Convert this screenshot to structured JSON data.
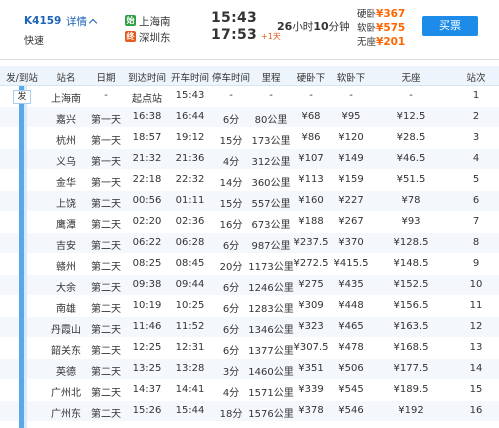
{
  "train": {
    "number": "K4159",
    "detail_label": "详情",
    "type": "快速",
    "from_badge": "始",
    "to_badge": "终",
    "from_station": "上海南",
    "to_station": "深圳东",
    "depart_time": "15:43",
    "arrive_time": "17:53",
    "day_offset": "+1天",
    "duration_hours": "26",
    "duration_hours_unit": "小时",
    "duration_minutes": "10",
    "duration_minutes_unit": "分钟",
    "prices": [
      {
        "seat": "硬卧",
        "value": "¥367"
      },
      {
        "seat": "软卧",
        "value": "¥575"
      },
      {
        "seat": "无座",
        "value": "¥201"
      }
    ],
    "buy_label": "买票"
  },
  "colors": {
    "accent_blue": "#1c8ce8",
    "price_orange": "#ff6600",
    "badge_green": "#2f9e44",
    "badge_orange": "#e55a1c"
  },
  "table": {
    "headers": [
      "发/到站",
      "站名",
      "日期",
      "到达时间",
      "开车时间",
      "停车时间",
      "里程",
      "硬卧下",
      "软卧下",
      "无座",
      "站次"
    ],
    "depart_marker": "发",
    "rows": [
      [
        "上海南",
        "-",
        "起点站",
        "15:43",
        "-",
        "-",
        "-",
        "-",
        "-",
        "1"
      ],
      [
        "嘉兴",
        "第一天",
        "16:38",
        "16:44",
        "6分",
        "80公里",
        "¥68",
        "¥95",
        "¥12.5",
        "2"
      ],
      [
        "杭州",
        "第一天",
        "18:57",
        "19:12",
        "15分",
        "173公里",
        "¥86",
        "¥120",
        "¥28.5",
        "3"
      ],
      [
        "义乌",
        "第一天",
        "21:32",
        "21:36",
        "4分",
        "312公里",
        "¥107",
        "¥149",
        "¥46.5",
        "4"
      ],
      [
        "金华",
        "第一天",
        "22:18",
        "22:32",
        "14分",
        "360公里",
        "¥113",
        "¥159",
        "¥51.5",
        "5"
      ],
      [
        "上饶",
        "第二天",
        "00:56",
        "01:11",
        "15分",
        "557公里",
        "¥160",
        "¥227",
        "¥78",
        "6"
      ],
      [
        "鹰潭",
        "第二天",
        "02:20",
        "02:36",
        "16分",
        "673公里",
        "¥188",
        "¥267",
        "¥93",
        "7"
      ],
      [
        "吉安",
        "第二天",
        "06:22",
        "06:28",
        "6分",
        "987公里",
        "¥237.5",
        "¥370",
        "¥128.5",
        "8"
      ],
      [
        "赣州",
        "第二天",
        "08:25",
        "08:45",
        "20分",
        "1173公里",
        "¥272.5",
        "¥415.5",
        "¥148.5",
        "9"
      ],
      [
        "大余",
        "第二天",
        "09:38",
        "09:44",
        "6分",
        "1246公里",
        "¥275",
        "¥435",
        "¥152.5",
        "10"
      ],
      [
        "南雄",
        "第二天",
        "10:19",
        "10:25",
        "6分",
        "1283公里",
        "¥309",
        "¥448",
        "¥156.5",
        "11"
      ],
      [
        "丹霞山",
        "第二天",
        "11:46",
        "11:52",
        "6分",
        "1346公里",
        "¥323",
        "¥465",
        "¥163.5",
        "12"
      ],
      [
        "韶关东",
        "第二天",
        "12:25",
        "12:31",
        "6分",
        "1377公里",
        "¥307.5",
        "¥478",
        "¥168.5",
        "13"
      ],
      [
        "英德",
        "第二天",
        "13:25",
        "13:28",
        "3分",
        "1460公里",
        "¥351",
        "¥506",
        "¥177.5",
        "14"
      ],
      [
        "广州北",
        "第二天",
        "14:37",
        "14:41",
        "4分",
        "1571公里",
        "¥339",
        "¥545",
        "¥189.5",
        "15"
      ],
      [
        "广州东",
        "第二天",
        "15:26",
        "15:44",
        "18分",
        "1576公里",
        "¥378",
        "¥546",
        "¥192",
        "16"
      ]
    ]
  }
}
